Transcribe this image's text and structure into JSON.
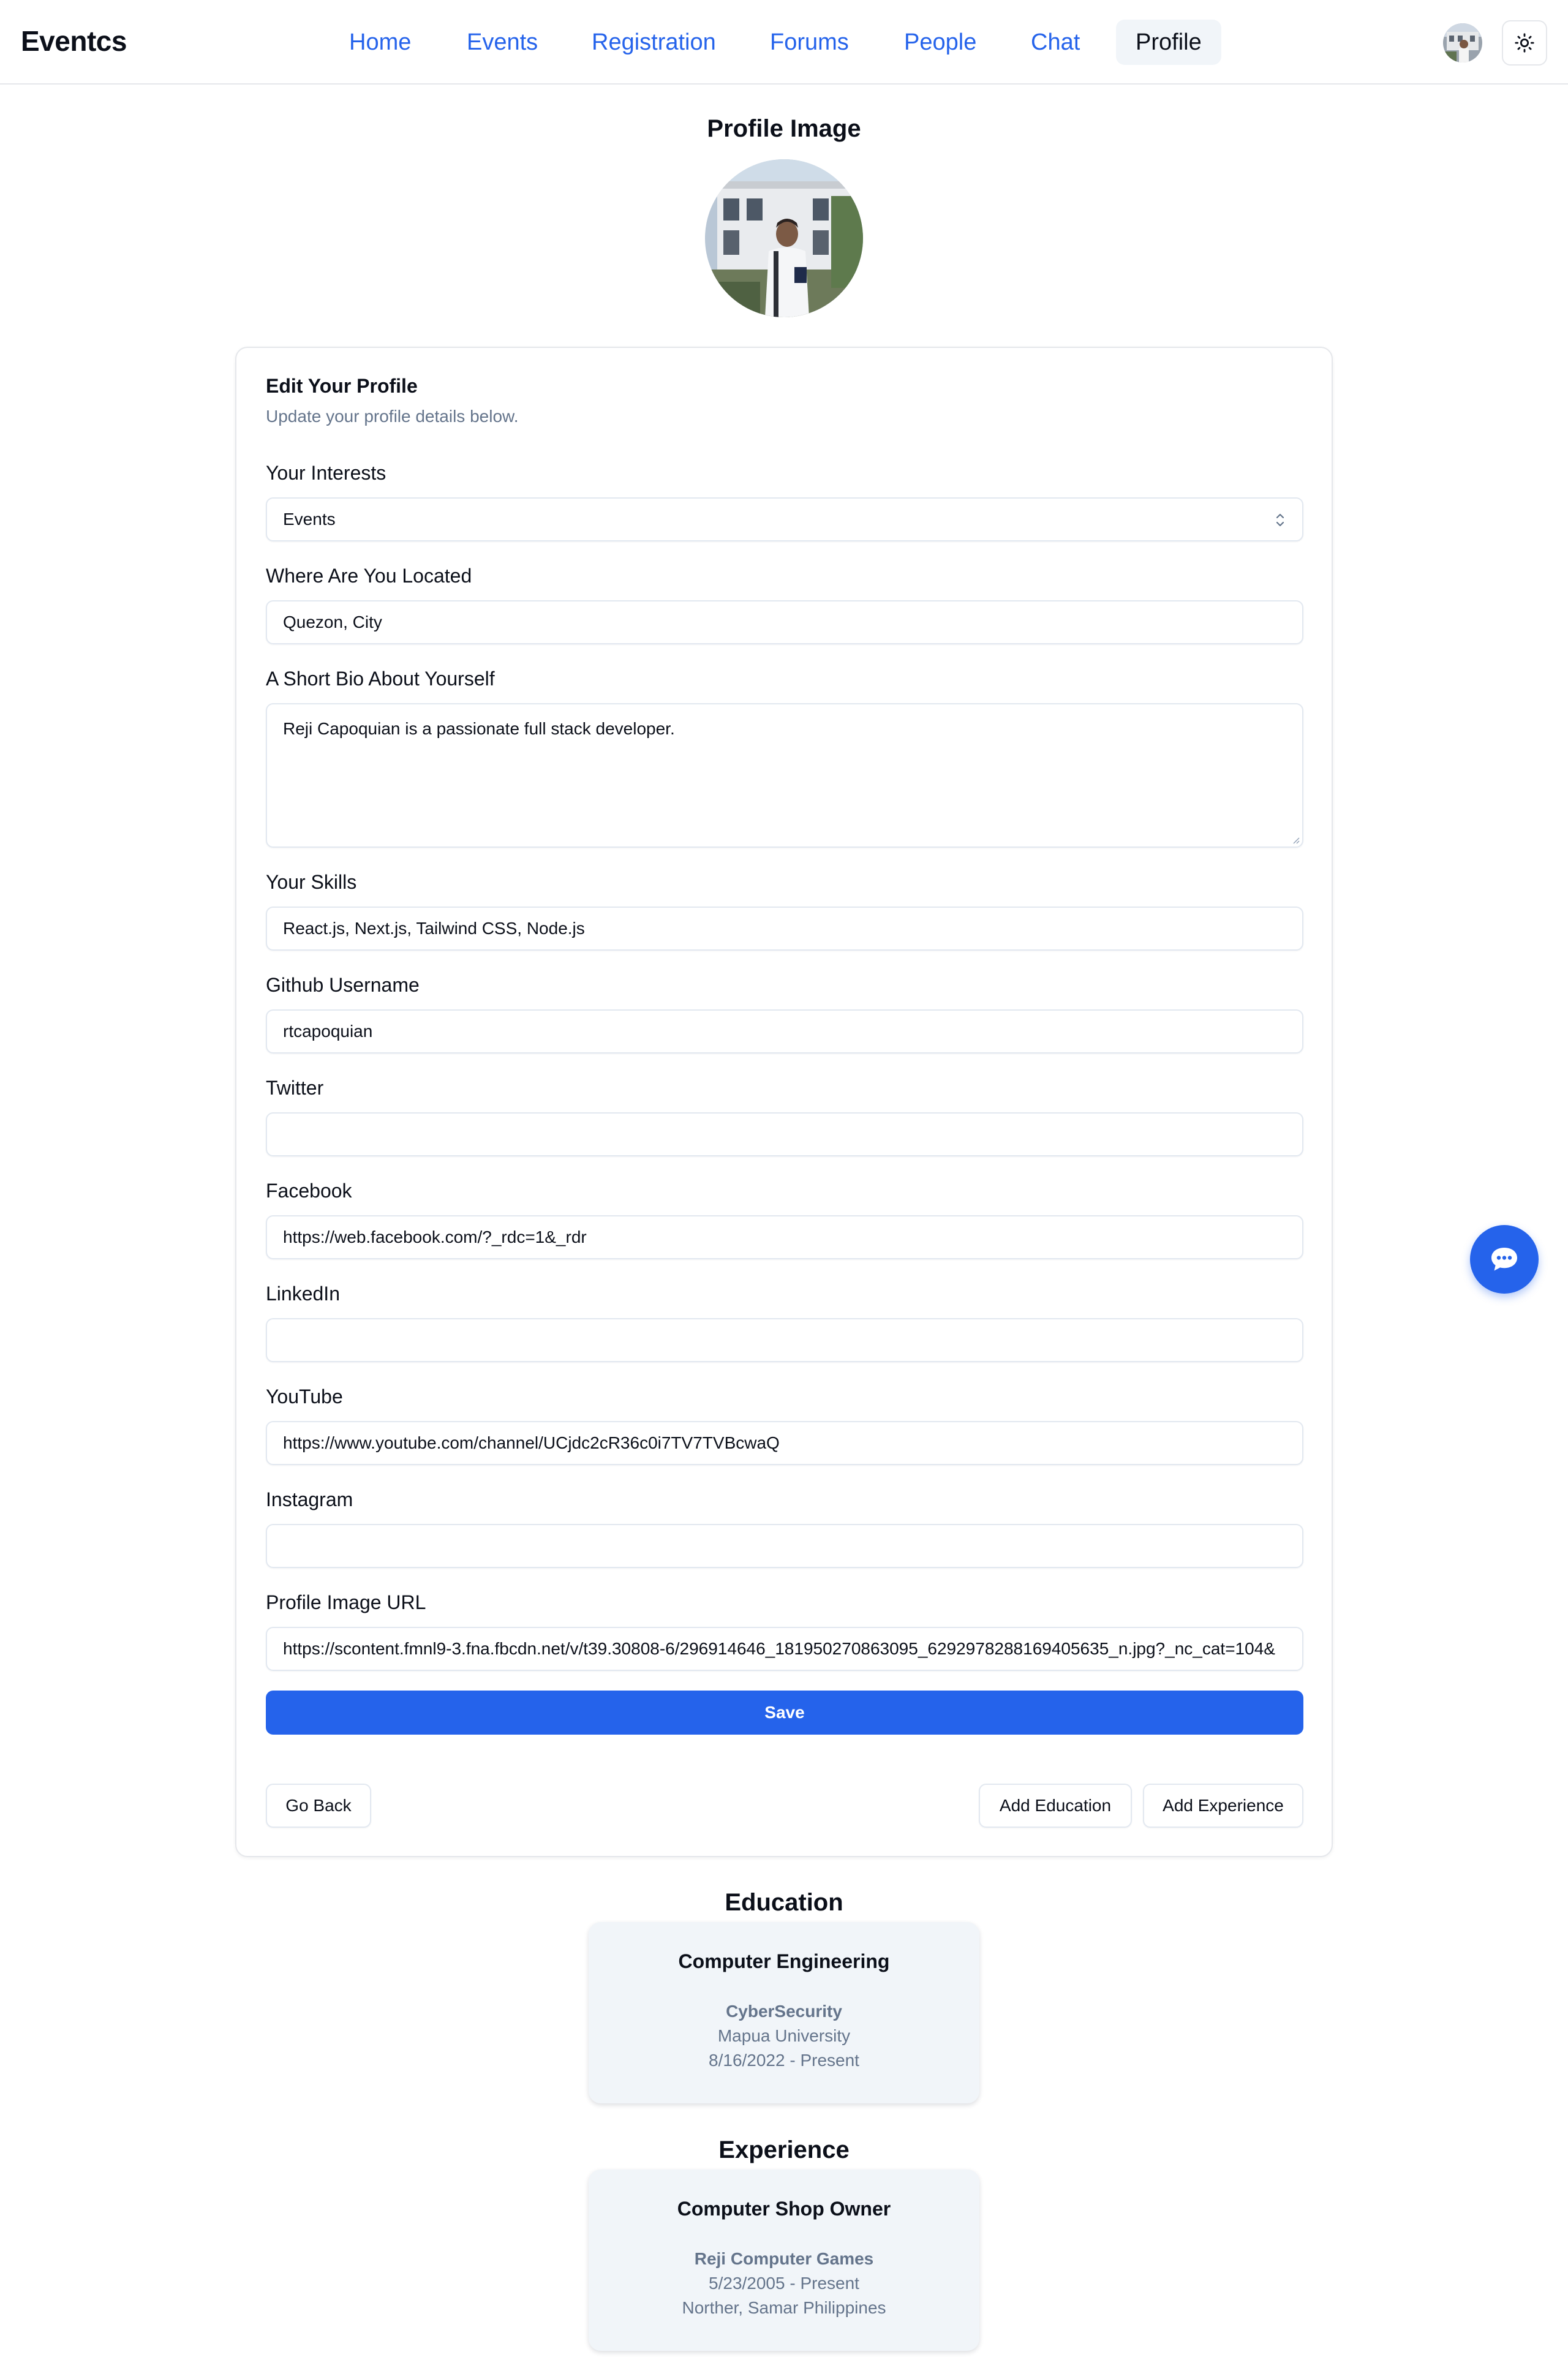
{
  "nav": {
    "brand": "Eventcs",
    "links": [
      "Home",
      "Events",
      "Registration",
      "Forums",
      "People",
      "Chat",
      "Profile"
    ],
    "active": "Profile",
    "avatar_icon": "user-avatar",
    "theme_icon": "sun-icon"
  },
  "profile_image": {
    "title": "Profile Image"
  },
  "form": {
    "title": "Edit Your Profile",
    "subtitle": "Update your profile details below.",
    "interests": {
      "label": "Your Interests",
      "value": "Events"
    },
    "location": {
      "label": "Where Are You Located",
      "value": "Quezon, City"
    },
    "bio": {
      "label": "A Short Bio About Yourself",
      "value": "Reji Capoquian is a passionate full stack developer."
    },
    "skills": {
      "label": "Your Skills",
      "value": "React.js, Next.js, Tailwind CSS, Node.js"
    },
    "github": {
      "label": "Github Username",
      "value": "rtcapoquian"
    },
    "twitter": {
      "label": "Twitter",
      "value": ""
    },
    "facebook": {
      "label": "Facebook",
      "value": "https://web.facebook.com/?_rdc=1&_rdr"
    },
    "linkedin": {
      "label": "LinkedIn",
      "value": ""
    },
    "youtube": {
      "label": "YouTube",
      "value": "https://www.youtube.com/channel/UCjdc2cR36c0i7TV7TVBcwaQ"
    },
    "instagram": {
      "label": "Instagram",
      "value": ""
    },
    "image_url": {
      "label": "Profile Image URL",
      "value": "https://scontent.fmnl9-3.fna.fbcdn.net/v/t39.30808-6/296914646_181950270863095_6292978288169405635_n.jpg?_nc_cat=104&"
    },
    "save_label": "Save",
    "go_back_label": "Go Back",
    "add_education_label": "Add Education",
    "add_experience_label": "Add Experience"
  },
  "education": {
    "title": "Education",
    "items": [
      {
        "degree": "Computer Engineering",
        "field": "CyberSecurity",
        "school": "Mapua University",
        "dates": "8/16/2022 - Present"
      }
    ]
  },
  "experience": {
    "title": "Experience",
    "items": [
      {
        "title": "Computer Shop Owner",
        "company": "Reji Computer Games",
        "dates": "5/23/2005 - Present",
        "location": "Norther, Samar Philippines"
      }
    ]
  },
  "colors": {
    "primary": "#2563eb",
    "muted": "#64748b",
    "card_bg": "#f1f5f9",
    "border": "#e2e8f0"
  },
  "fab_icon": "chat-bubble-icon"
}
